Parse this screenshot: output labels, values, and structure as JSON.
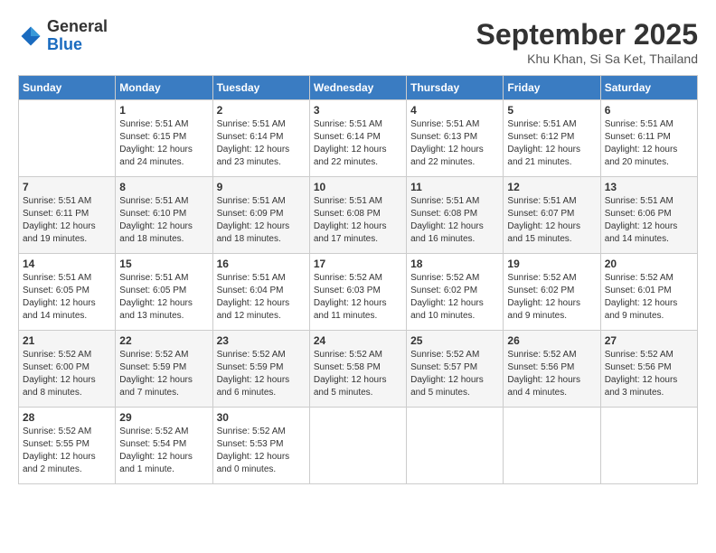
{
  "header": {
    "logo": {
      "general": "General",
      "blue": "Blue"
    },
    "title": "September 2025",
    "location": "Khu Khan, Si Sa Ket, Thailand"
  },
  "weekdays": [
    "Sunday",
    "Monday",
    "Tuesday",
    "Wednesday",
    "Thursday",
    "Friday",
    "Saturday"
  ],
  "weeks": [
    [
      {
        "day": "",
        "sunrise": "",
        "sunset": "",
        "daylight": ""
      },
      {
        "day": "1",
        "sunrise": "Sunrise: 5:51 AM",
        "sunset": "Sunset: 6:15 PM",
        "daylight": "Daylight: 12 hours and 24 minutes."
      },
      {
        "day": "2",
        "sunrise": "Sunrise: 5:51 AM",
        "sunset": "Sunset: 6:14 PM",
        "daylight": "Daylight: 12 hours and 23 minutes."
      },
      {
        "day": "3",
        "sunrise": "Sunrise: 5:51 AM",
        "sunset": "Sunset: 6:14 PM",
        "daylight": "Daylight: 12 hours and 22 minutes."
      },
      {
        "day": "4",
        "sunrise": "Sunrise: 5:51 AM",
        "sunset": "Sunset: 6:13 PM",
        "daylight": "Daylight: 12 hours and 22 minutes."
      },
      {
        "day": "5",
        "sunrise": "Sunrise: 5:51 AM",
        "sunset": "Sunset: 6:12 PM",
        "daylight": "Daylight: 12 hours and 21 minutes."
      },
      {
        "day": "6",
        "sunrise": "Sunrise: 5:51 AM",
        "sunset": "Sunset: 6:11 PM",
        "daylight": "Daylight: 12 hours and 20 minutes."
      }
    ],
    [
      {
        "day": "7",
        "sunrise": "Sunrise: 5:51 AM",
        "sunset": "Sunset: 6:11 PM",
        "daylight": "Daylight: 12 hours and 19 minutes."
      },
      {
        "day": "8",
        "sunrise": "Sunrise: 5:51 AM",
        "sunset": "Sunset: 6:10 PM",
        "daylight": "Daylight: 12 hours and 18 minutes."
      },
      {
        "day": "9",
        "sunrise": "Sunrise: 5:51 AM",
        "sunset": "Sunset: 6:09 PM",
        "daylight": "Daylight: 12 hours and 18 minutes."
      },
      {
        "day": "10",
        "sunrise": "Sunrise: 5:51 AM",
        "sunset": "Sunset: 6:08 PM",
        "daylight": "Daylight: 12 hours and 17 minutes."
      },
      {
        "day": "11",
        "sunrise": "Sunrise: 5:51 AM",
        "sunset": "Sunset: 6:08 PM",
        "daylight": "Daylight: 12 hours and 16 minutes."
      },
      {
        "day": "12",
        "sunrise": "Sunrise: 5:51 AM",
        "sunset": "Sunset: 6:07 PM",
        "daylight": "Daylight: 12 hours and 15 minutes."
      },
      {
        "day": "13",
        "sunrise": "Sunrise: 5:51 AM",
        "sunset": "Sunset: 6:06 PM",
        "daylight": "Daylight: 12 hours and 14 minutes."
      }
    ],
    [
      {
        "day": "14",
        "sunrise": "Sunrise: 5:51 AM",
        "sunset": "Sunset: 6:05 PM",
        "daylight": "Daylight: 12 hours and 14 minutes."
      },
      {
        "day": "15",
        "sunrise": "Sunrise: 5:51 AM",
        "sunset": "Sunset: 6:05 PM",
        "daylight": "Daylight: 12 hours and 13 minutes."
      },
      {
        "day": "16",
        "sunrise": "Sunrise: 5:51 AM",
        "sunset": "Sunset: 6:04 PM",
        "daylight": "Daylight: 12 hours and 12 minutes."
      },
      {
        "day": "17",
        "sunrise": "Sunrise: 5:52 AM",
        "sunset": "Sunset: 6:03 PM",
        "daylight": "Daylight: 12 hours and 11 minutes."
      },
      {
        "day": "18",
        "sunrise": "Sunrise: 5:52 AM",
        "sunset": "Sunset: 6:02 PM",
        "daylight": "Daylight: 12 hours and 10 minutes."
      },
      {
        "day": "19",
        "sunrise": "Sunrise: 5:52 AM",
        "sunset": "Sunset: 6:02 PM",
        "daylight": "Daylight: 12 hours and 9 minutes."
      },
      {
        "day": "20",
        "sunrise": "Sunrise: 5:52 AM",
        "sunset": "Sunset: 6:01 PM",
        "daylight": "Daylight: 12 hours and 9 minutes."
      }
    ],
    [
      {
        "day": "21",
        "sunrise": "Sunrise: 5:52 AM",
        "sunset": "Sunset: 6:00 PM",
        "daylight": "Daylight: 12 hours and 8 minutes."
      },
      {
        "day": "22",
        "sunrise": "Sunrise: 5:52 AM",
        "sunset": "Sunset: 5:59 PM",
        "daylight": "Daylight: 12 hours and 7 minutes."
      },
      {
        "day": "23",
        "sunrise": "Sunrise: 5:52 AM",
        "sunset": "Sunset: 5:59 PM",
        "daylight": "Daylight: 12 hours and 6 minutes."
      },
      {
        "day": "24",
        "sunrise": "Sunrise: 5:52 AM",
        "sunset": "Sunset: 5:58 PM",
        "daylight": "Daylight: 12 hours and 5 minutes."
      },
      {
        "day": "25",
        "sunrise": "Sunrise: 5:52 AM",
        "sunset": "Sunset: 5:57 PM",
        "daylight": "Daylight: 12 hours and 5 minutes."
      },
      {
        "day": "26",
        "sunrise": "Sunrise: 5:52 AM",
        "sunset": "Sunset: 5:56 PM",
        "daylight": "Daylight: 12 hours and 4 minutes."
      },
      {
        "day": "27",
        "sunrise": "Sunrise: 5:52 AM",
        "sunset": "Sunset: 5:56 PM",
        "daylight": "Daylight: 12 hours and 3 minutes."
      }
    ],
    [
      {
        "day": "28",
        "sunrise": "Sunrise: 5:52 AM",
        "sunset": "Sunset: 5:55 PM",
        "daylight": "Daylight: 12 hours and 2 minutes."
      },
      {
        "day": "29",
        "sunrise": "Sunrise: 5:52 AM",
        "sunset": "Sunset: 5:54 PM",
        "daylight": "Daylight: 12 hours and 1 minute."
      },
      {
        "day": "30",
        "sunrise": "Sunrise: 5:52 AM",
        "sunset": "Sunset: 5:53 PM",
        "daylight": "Daylight: 12 hours and 0 minutes."
      },
      {
        "day": "",
        "sunrise": "",
        "sunset": "",
        "daylight": ""
      },
      {
        "day": "",
        "sunrise": "",
        "sunset": "",
        "daylight": ""
      },
      {
        "day": "",
        "sunrise": "",
        "sunset": "",
        "daylight": ""
      },
      {
        "day": "",
        "sunrise": "",
        "sunset": "",
        "daylight": ""
      }
    ]
  ]
}
